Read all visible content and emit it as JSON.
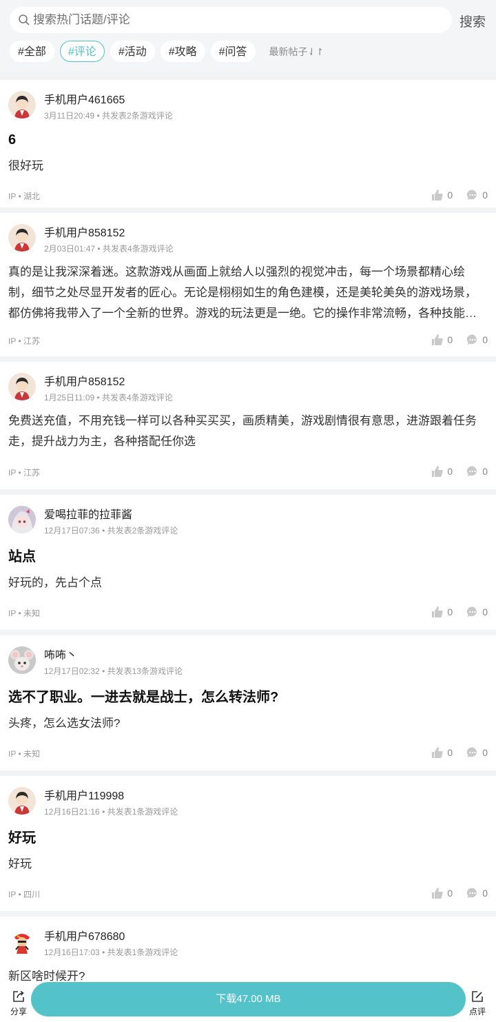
{
  "search": {
    "placeholder": "搜索热门话题/评论",
    "button": "搜索"
  },
  "tabs": [
    "#全部",
    "#评论",
    "#活动",
    "#攻略",
    "#问答"
  ],
  "sort_label": "最新帖子⇃↾",
  "posts": [
    {
      "user": "手机用户461665",
      "time": "3月11日20:49",
      "summary": "共发表2条游戏评论",
      "title": "6",
      "body": "很好玩",
      "ip": "IP • 湖北",
      "likes": "0",
      "comments": "0"
    },
    {
      "user": "手机用户858152",
      "time": "2月03日01:47",
      "summary": "共发表4条游戏评论",
      "title": "",
      "body": "真的是让我深深着迷。这款游戏从画面上就给人以强烈的视觉冲击，每一个场景都精心绘制，细节之处尽显开发者的匠心。无论是栩栩如生的角色建模，还是美轮美奂的游戏场景，都仿佛将我带入了一个全新的世界。游戏的玩法更是一绝。它的操作非常流畅，各种技能的释放都非常顺畅",
      "ip": "IP • 江苏",
      "likes": "0",
      "comments": "0"
    },
    {
      "user": "手机用户858152",
      "time": "1月25日11:09",
      "summary": "共发表4条游戏评论",
      "title": "",
      "body": "免费送充值，不用充钱一样可以各种买买买，画质精美，游戏剧情很有意思，进游跟着任务走，提升战力为主，各种搭配任你选",
      "ip": "IP • 江苏",
      "likes": "0",
      "comments": "0"
    },
    {
      "user": "爱喝拉菲的拉菲酱",
      "time": "12月17日07:36",
      "summary": "共发表2条游戏评论",
      "title": "站点",
      "body": "好玩的，先占个点",
      "ip": "IP • 未知",
      "likes": "0",
      "comments": "0"
    },
    {
      "user": "咘咘丶",
      "time": "12月17日02:32",
      "summary": "共发表13条游戏评论",
      "title": "选不了职业。一进去就是战士，怎么转法师?",
      "body": "头疼，怎么选女法师?",
      "ip": "IP • 未知",
      "likes": "0",
      "comments": "0"
    },
    {
      "user": "手机用户119998",
      "time": "12月16日21:16",
      "summary": "共发表1条游戏评论",
      "title": "好玩",
      "body": "好玩",
      "ip": "IP • 四川",
      "likes": "0",
      "comments": "0"
    },
    {
      "user": "手机用户678680",
      "time": "12月16日17:03",
      "summary": "共发表1条游戏评论",
      "title": "",
      "body": "新区啥时候开?",
      "ip": "",
      "likes": "",
      "comments": ""
    }
  ],
  "bottom": {
    "share": "分享",
    "download": "下载47.00 MB",
    "review": "点评"
  },
  "colors": {
    "accent": "#53c3c9",
    "tab_active": "#4fc3c8"
  }
}
